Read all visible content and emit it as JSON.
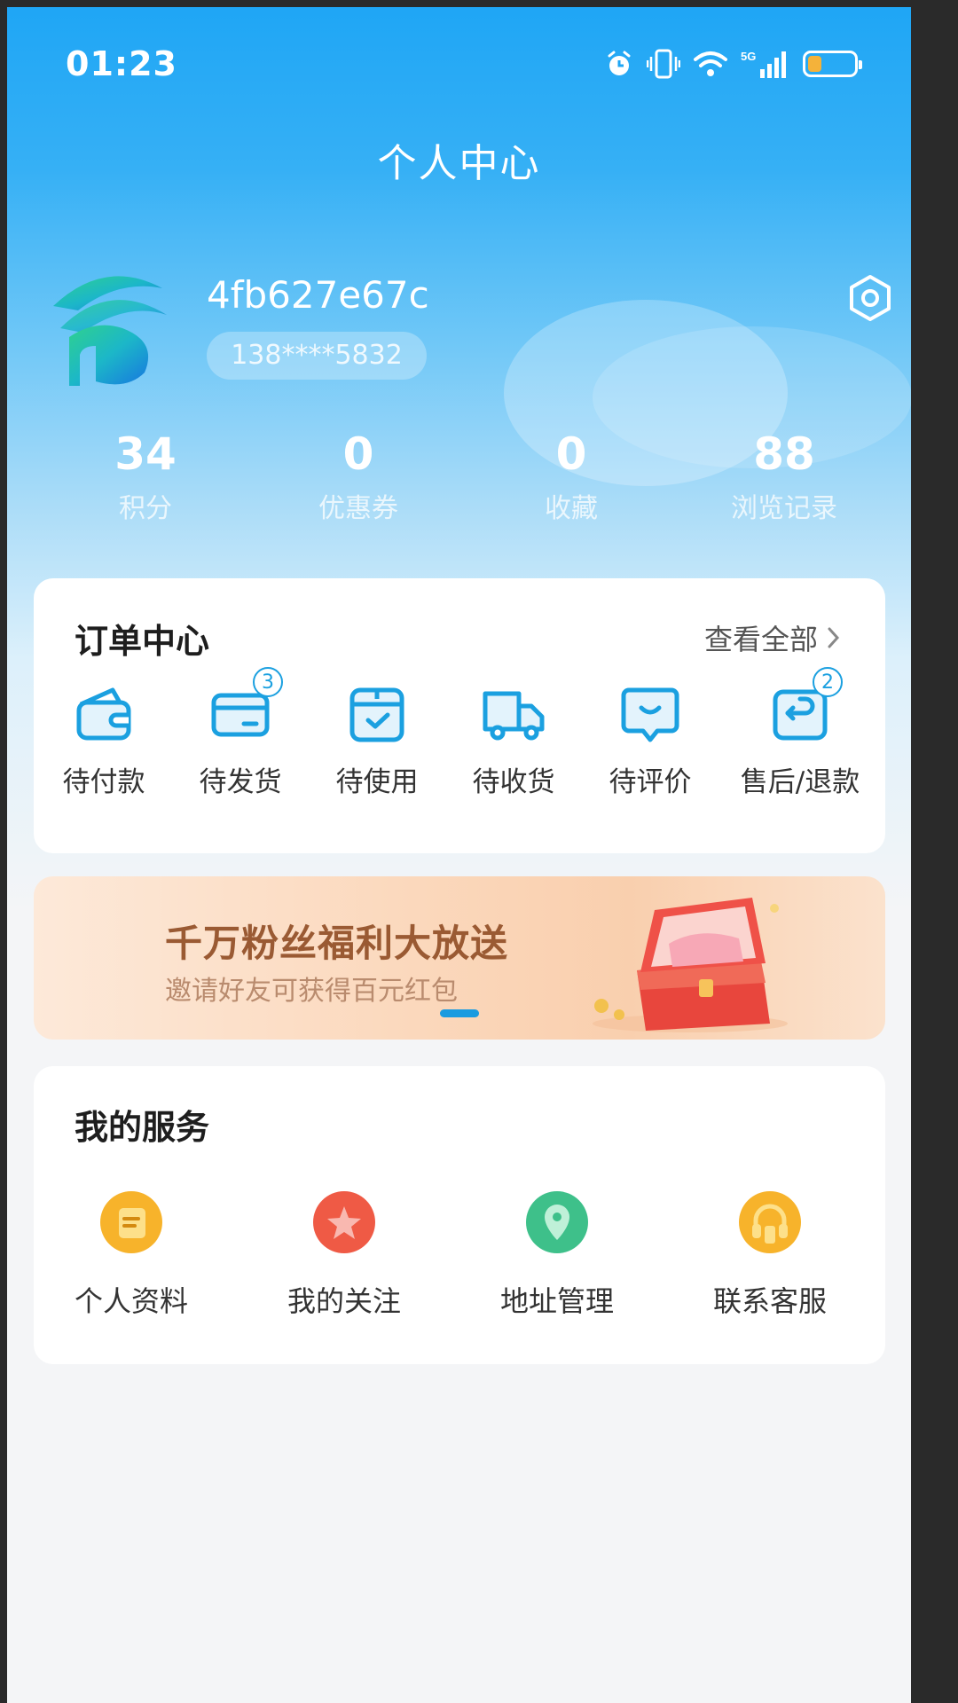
{
  "status_bar": {
    "time": "01:23",
    "icons": [
      "alarm-icon",
      "vibrate-icon",
      "wifi-icon",
      "5g-signal-icon",
      "battery-icon"
    ],
    "network_label": "5G",
    "battery_level": 0.3
  },
  "header": {
    "title": "个人中心"
  },
  "profile": {
    "username": "4fb627e67c",
    "phone": "138****5832",
    "avatar_icon": "app-logo-avatar",
    "settings_icon": "settings-icon"
  },
  "stats": [
    {
      "value": "34",
      "label": "积分"
    },
    {
      "value": "0",
      "label": "优惠券"
    },
    {
      "value": "0",
      "label": "收藏"
    },
    {
      "value": "88",
      "label": "浏览记录"
    }
  ],
  "orders": {
    "title": "订单中心",
    "view_all": "查看全部",
    "items": [
      {
        "label": "待付款",
        "icon": "wallet-icon",
        "badge": ""
      },
      {
        "label": "待发货",
        "icon": "card-icon",
        "badge": "3"
      },
      {
        "label": "待使用",
        "icon": "calendar-check-icon",
        "badge": ""
      },
      {
        "label": "待收货",
        "icon": "truck-icon",
        "badge": ""
      },
      {
        "label": "待评价",
        "icon": "comment-icon",
        "badge": ""
      },
      {
        "label": "售后/退款",
        "icon": "return-icon",
        "badge": "2"
      }
    ]
  },
  "banner": {
    "title": "千万粉丝福利大放送",
    "subtitle": "邀请好友可获得百元红包",
    "active_slide": 1
  },
  "services": {
    "title": "我的服务",
    "items": [
      {
        "label": "个人资料",
        "icon": "profile-card-icon",
        "color": "#f7b32b"
      },
      {
        "label": "我的关注",
        "icon": "star-icon",
        "color": "#ef5a45"
      },
      {
        "label": "地址管理",
        "icon": "location-pin-icon",
        "color": "#3ec08a"
      },
      {
        "label": "联系客服",
        "icon": "headset-icon",
        "color": "#f7b32b"
      }
    ]
  },
  "colors": {
    "header_blue": "#1fa6f5",
    "accent": "#1ba0e0",
    "banner_text": "#9a5a33"
  }
}
